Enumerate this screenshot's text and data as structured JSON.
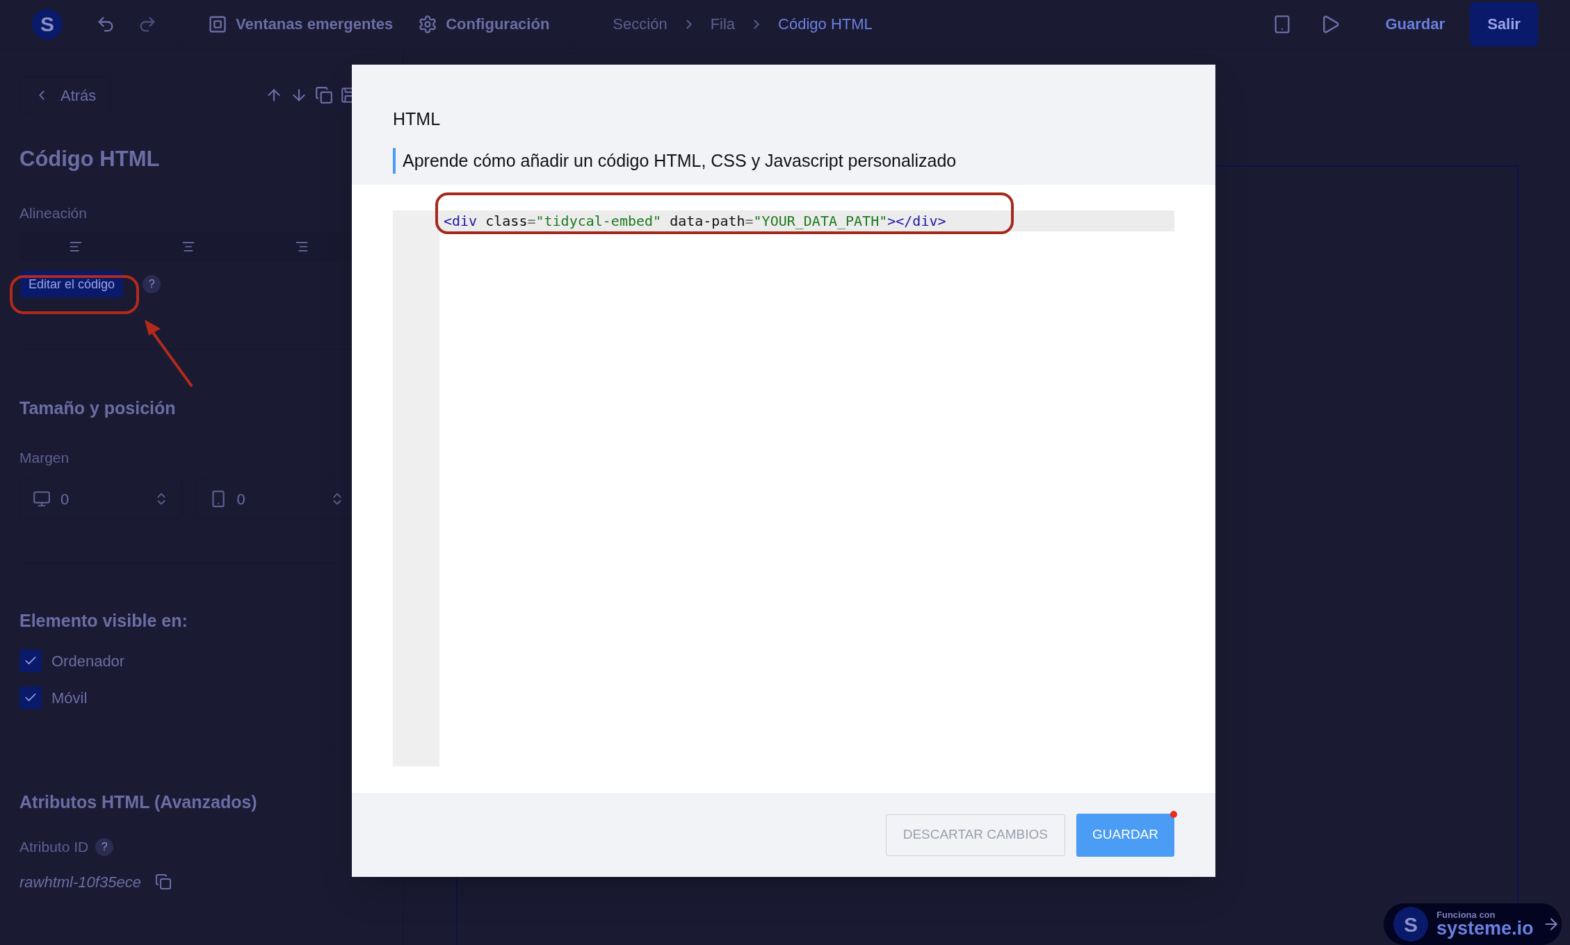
{
  "topbar": {
    "logo_letter": "S",
    "nav": [
      {
        "label": "Ventanas emergentes"
      },
      {
        "label": "Configuración"
      }
    ],
    "breadcrumbs": [
      {
        "label": "Sección",
        "current": false
      },
      {
        "label": "Fila",
        "current": false
      },
      {
        "label": "Código HTML",
        "current": true
      }
    ],
    "save": "Guardar",
    "exit": "Salir"
  },
  "sidebar": {
    "back": "Atrás",
    "title": "Código HTML",
    "alignment_label": "Alineación",
    "edit_code": "Editar el código",
    "help": "?",
    "size_title": "Tamaño y posición",
    "margin_label": "Margen",
    "margins": [
      {
        "value": "0"
      },
      {
        "value": "0"
      }
    ],
    "visible_title": "Elemento visible en:",
    "visible_on": [
      {
        "label": "Ordenador",
        "checked": true
      },
      {
        "label": "Móvil",
        "checked": true
      }
    ],
    "attributes_title": "Atributos HTML (Avanzados)",
    "id_label": "Atributo ID",
    "id_help": "?",
    "id_value": "rawhtml-10f35ece"
  },
  "modal": {
    "title": "HTML",
    "help_link": "Aprende cómo añadir un código HTML, CSS y Javascript personalizado",
    "code_tokens": [
      {
        "text": "<div",
        "kind": "tag"
      },
      {
        "text": " class",
        "kind": "attr"
      },
      {
        "text": "=",
        "kind": "op"
      },
      {
        "text": "\"tidycal-embed\"",
        "kind": "string"
      },
      {
        "text": " data-path",
        "kind": "attr"
      },
      {
        "text": "=",
        "kind": "op"
      },
      {
        "text": "\"YOUR_DATA_PATH\"",
        "kind": "string"
      },
      {
        "text": "></div>",
        "kind": "tag"
      }
    ],
    "discard": "DESCARTAR CAMBIOS",
    "save": "GUARDAR",
    "save_has_notification": true
  },
  "badge": {
    "logo_letter": "S",
    "caption": "Funciona con",
    "brand": "systeme.io"
  }
}
